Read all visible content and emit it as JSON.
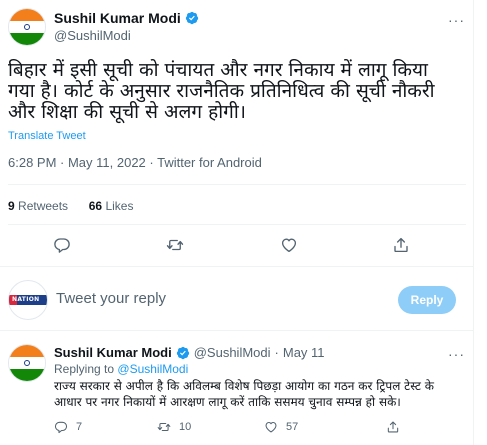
{
  "tweet": {
    "author_name": "Sushil Kumar Modi",
    "author_handle": "@SushilModi",
    "more_label": "···",
    "text_lines": [
      "बिहार में इसी सूची को पंचायत और नगर निकाय में लागू किया",
      "गया है। कोर्ट के अनुसार राजनैतिक प्रतिनिधित्व की सूची नौकरी",
      "और शिक्षा की सूची से अलग होगी।"
    ],
    "translate_label": "Translate Tweet",
    "meta": "6:28 PM · May 11, 2022 · Twitter for Android",
    "retweets_count": "9",
    "retweets_label": "Retweets",
    "likes_count": "66",
    "likes_label": "Likes"
  },
  "composer": {
    "avatar_text": "NATION",
    "placeholder": "Tweet your reply",
    "reply_button": "Reply"
  },
  "reply": {
    "author_name": "Sushil Kumar Modi",
    "author_handle": "@SushilModi",
    "separator": "·",
    "date": "May 11",
    "more_label": "···",
    "replying_prefix": "Replying to",
    "replying_handle": "@SushilModi",
    "text_lines": [
      "राज्य सरकार से अपील है कि अविलम्ब विशेष पिछड़ा आयोग का गठन कर ट्रिपल टेस्ट के",
      "आधार पर नगर निकायों में आरक्षण लागू करें ताकि ससमय चुनाव सम्पन्न हो सके।"
    ],
    "reply_count": "7",
    "retweet_count": "10",
    "like_count": "57"
  },
  "colors": {
    "accent": "#1d9bf0",
    "reply_button_disabled": "#8ecdf8",
    "secondary_text": "#536471",
    "divider": "#eff3f4"
  },
  "icons": [
    "verified-badge-icon",
    "reply-icon",
    "retweet-icon",
    "like-icon",
    "share-icon",
    "more-icon"
  ]
}
